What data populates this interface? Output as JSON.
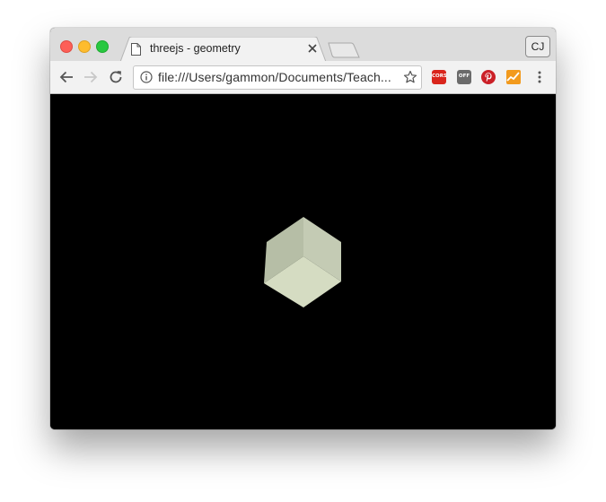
{
  "browser": {
    "tab": {
      "title": "threejs - geometry",
      "page_icon": "document-icon"
    },
    "profile_initials": "CJ",
    "address_bar": {
      "url": "file:///Users/gammon/Documents/Teach..."
    },
    "extensions": [
      {
        "name": "cors-extension",
        "label": "CORS",
        "color": "#d9251c"
      },
      {
        "name": "off-extension",
        "label": "OFF",
        "color": "#6b6b6b"
      },
      {
        "name": "pinterest-extension",
        "color": "#cb2027"
      },
      {
        "name": "chart-extension",
        "color": "#f29a1d"
      }
    ]
  },
  "viewport": {
    "background": "#000000",
    "object": "cube",
    "cube_colors": {
      "top_left": "#b6bea6",
      "top_right": "#c4cbb4",
      "bottom": "#d5dcc2"
    }
  }
}
